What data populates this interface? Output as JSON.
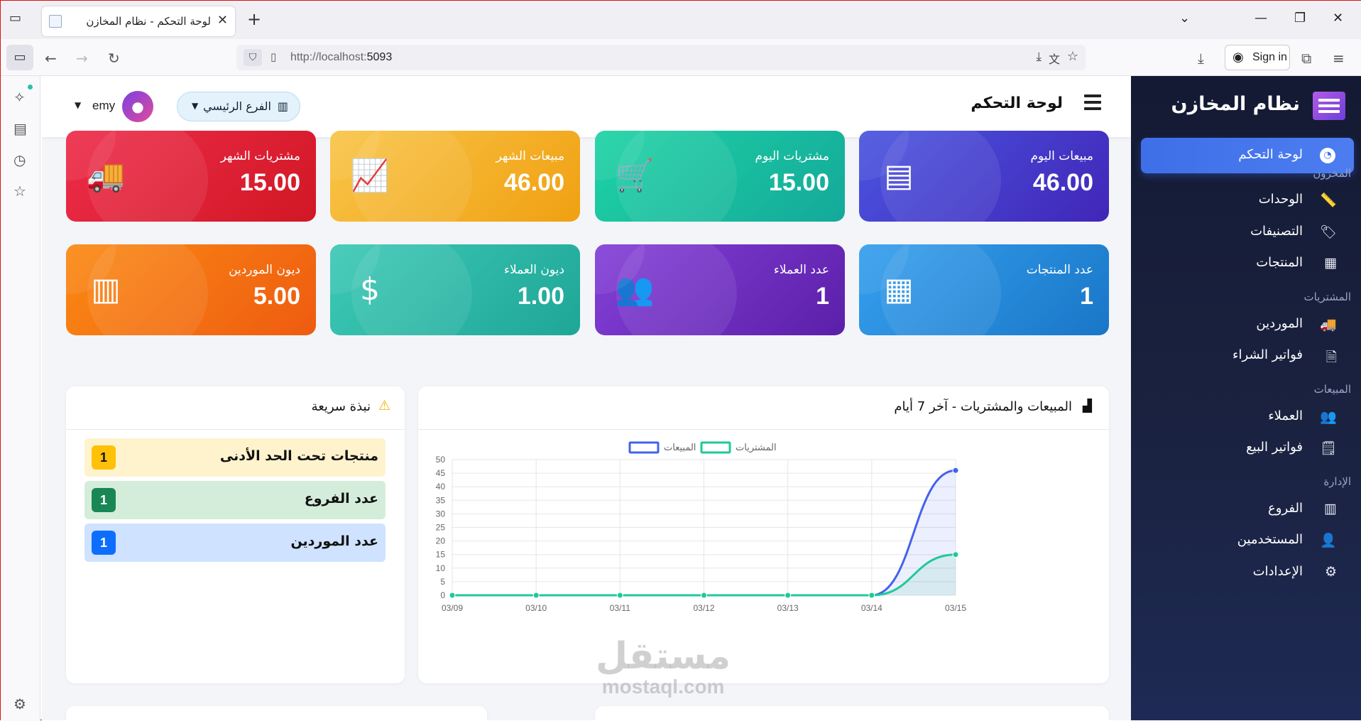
{
  "browser": {
    "tab_title": "لوحة التحكم - نظام المخازن",
    "url_prefix": "http://localhost:",
    "url_port": "5093",
    "sign_in": "Sign in"
  },
  "app": {
    "brand": "نظام المخازن",
    "page_title": "لوحة التحكم",
    "branch": "الفرع الرئيسي",
    "user": "emy"
  },
  "sidebar": {
    "active": "لوحة التحكم",
    "sections": [
      {
        "title": "المخزون",
        "items": [
          {
            "label": "الوحدات",
            "icon": "ruler-icon"
          },
          {
            "label": "التصنيفات",
            "icon": "tags-icon"
          },
          {
            "label": "المنتجات",
            "icon": "boxes-icon"
          }
        ]
      },
      {
        "title": "المشتريات",
        "items": [
          {
            "label": "الموردين",
            "icon": "truck-icon"
          },
          {
            "label": "فواتير الشراء",
            "icon": "invoice-icon"
          }
        ]
      },
      {
        "title": "المبيعات",
        "items": [
          {
            "label": "العملاء",
            "icon": "users-icon"
          },
          {
            "label": "فواتير البيع",
            "icon": "sales-invoice-icon"
          }
        ]
      },
      {
        "title": "الإدارة",
        "items": [
          {
            "label": "الفروع",
            "icon": "building-icon"
          },
          {
            "label": "المستخدمين",
            "icon": "user-cog-icon"
          },
          {
            "label": "الإعدادات",
            "icon": "gear-icon"
          }
        ]
      }
    ]
  },
  "stats": [
    {
      "label": "مبيعات اليوم",
      "value": "46.00",
      "icon": "cash-register-icon",
      "color": "#4a55e0"
    },
    {
      "label": "مشتريات اليوم",
      "value": "15.00",
      "icon": "cart-icon",
      "color": "#1ed3a4"
    },
    {
      "label": "مبيعات الشهر",
      "value": "46.00",
      "icon": "chart-line-icon",
      "color": "#f9c548"
    },
    {
      "label": "مشتريات الشهر",
      "value": "15.00",
      "icon": "truck-icon",
      "color": "#ee2d4b"
    },
    {
      "label": "عدد المنتجات",
      "value": "1",
      "icon": "boxes-icon",
      "color": "#36a0ee"
    },
    {
      "label": "عدد العملاء",
      "value": "1",
      "icon": "users-icon",
      "color": "#8440d8"
    },
    {
      "label": "ديون العملاء",
      "value": "1.00",
      "icon": "hand-dollar-icon",
      "color": "#3ec9b6"
    },
    {
      "label": "ديون الموردين",
      "value": "5.00",
      "icon": "building-icon",
      "color": "#fb8a14"
    }
  ],
  "chart_panel": {
    "title": "المبيعات والمشتريات - آخر 7 أيام"
  },
  "quick": {
    "title": "نبذة سريعة",
    "items": [
      {
        "label": "منتجات تحت الحد الأدنى",
        "count": "1",
        "bg": "#fff3cd",
        "badge": "#ffc107",
        "badge_text": "#111"
      },
      {
        "label": "عدد الفروع",
        "count": "1",
        "bg": "#d4edda",
        "badge": "#198754",
        "badge_text": "#fff"
      },
      {
        "label": "عدد الموردين",
        "count": "1",
        "bg": "#cfe2ff",
        "badge": "#0d6efd",
        "badge_text": "#fff"
      }
    ]
  },
  "watermark": {
    "ar": "مستقل",
    "en": "mostaql.com"
  },
  "chart_data": {
    "type": "line",
    "categories": [
      "03/09",
      "03/10",
      "03/11",
      "03/12",
      "03/13",
      "03/14",
      "03/15"
    ],
    "series": [
      {
        "name": "المبيعات",
        "values": [
          0,
          0,
          0,
          0,
          0,
          0,
          46
        ],
        "color": "#4361ee"
      },
      {
        "name": "المشتريات",
        "values": [
          0,
          0,
          0,
          0,
          0,
          0,
          15
        ],
        "color": "#20c997"
      }
    ],
    "ylim": [
      0,
      50
    ],
    "yticks": [
      0,
      5,
      10,
      15,
      20,
      25,
      30,
      35,
      40,
      45,
      50
    ],
    "legend": "top",
    "grid": true
  }
}
